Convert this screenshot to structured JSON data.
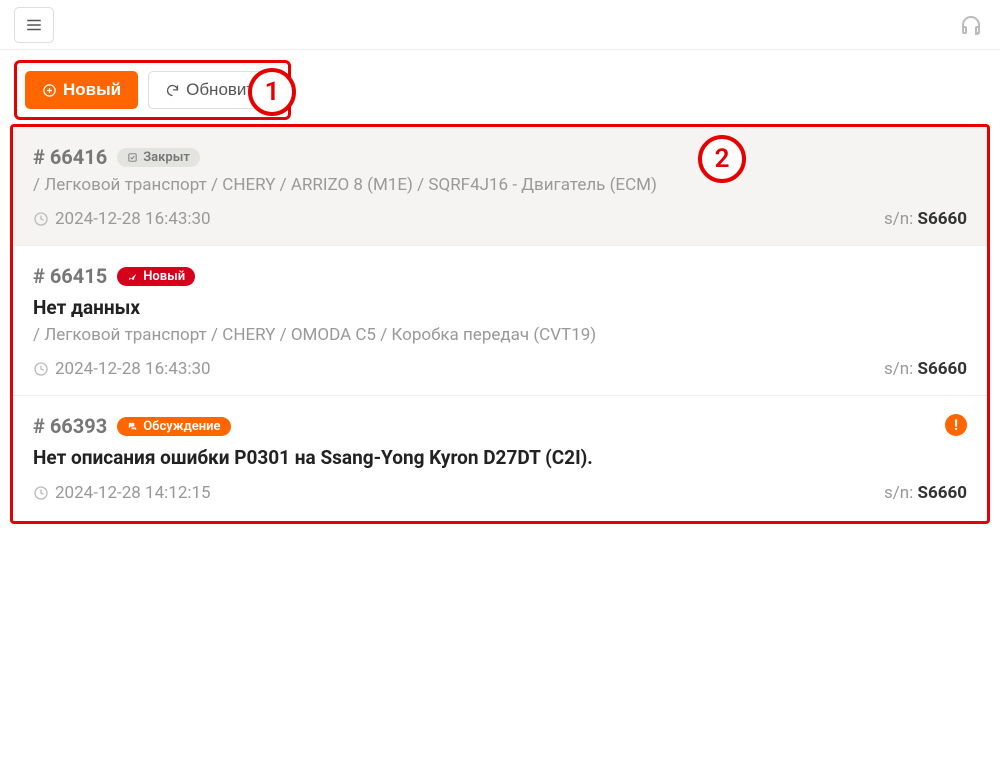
{
  "toolbar": {
    "new_label": "Новый",
    "refresh_label": "Обновить"
  },
  "callouts": {
    "c1": "1",
    "c2": "2"
  },
  "sn_prefix": "s/n:",
  "tickets": [
    {
      "id": "# 66416",
      "status_label": "Закрыт",
      "status_kind": "closed",
      "title": "",
      "path": "/ Легковой транспорт / CHERY / ARRIZO 8 (M1E) / SQRF4J16 - Двигатель (ECM)",
      "timestamp": "2024-12-28 16:43:30",
      "sn": "S6660",
      "has_alert": false
    },
    {
      "id": "# 66415",
      "status_label": "Новый",
      "status_kind": "new",
      "title": "Нет данных",
      "path": "/ Легковой транспорт / CHERY / OMODA C5 / Коробка передач (CVT19)",
      "timestamp": "2024-12-28 16:43:30",
      "sn": "S6660",
      "has_alert": false
    },
    {
      "id": "# 66393",
      "status_label": "Обсуждение",
      "status_kind": "discuss",
      "title": "Нет описания ошибки P0301 на Ssang-Yong Kyron D27DT (C2I).",
      "path": "",
      "timestamp": "2024-12-28 14:12:15",
      "sn": "S6660",
      "has_alert": true
    }
  ]
}
